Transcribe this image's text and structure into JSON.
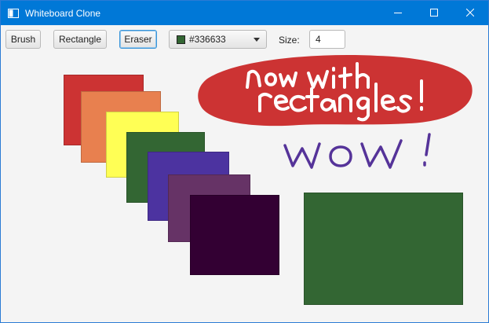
{
  "window": {
    "title": "Whiteboard Clone",
    "controls": [
      "minimize",
      "maximize",
      "close"
    ]
  },
  "toolbar": {
    "brush_label": "Brush",
    "rectangle_label": "Rectangle",
    "eraser_label": "Eraser",
    "active_tool": "Eraser",
    "color_value": "#336633",
    "size_label": "Size:",
    "size_value": "4"
  },
  "canvas": {
    "background": "#f4f4f4",
    "rectangles": [
      {
        "name": "red",
        "color": "#cc3333"
      },
      {
        "name": "orange",
        "color": "#e8804f"
      },
      {
        "name": "yellow",
        "color": "#ffff55"
      },
      {
        "name": "green",
        "color": "#336633"
      },
      {
        "name": "indigo",
        "color": "#4c33a0"
      },
      {
        "name": "purple",
        "color": "#663366"
      },
      {
        "name": "dark-purple",
        "color": "#330033"
      },
      {
        "name": "large-green",
        "color": "#336633"
      }
    ],
    "handwriting": {
      "banner_fill": "#cc3333",
      "banner_text_line1": "now with",
      "banner_text_line2": "rectangles!",
      "banner_text_color": "#ffffff",
      "wow_text": "WOW!",
      "wow_color": "#553399"
    }
  }
}
